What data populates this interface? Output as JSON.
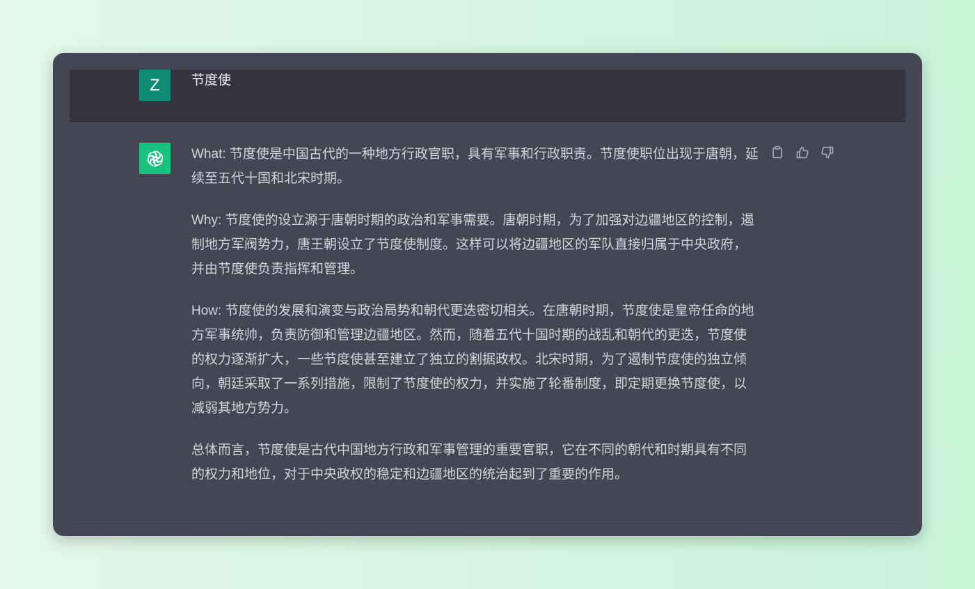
{
  "user_message": {
    "avatar_letter": "Z",
    "avatar_color": "#0f8a74",
    "text": "节度使"
  },
  "assistant_message": {
    "avatar_icon": "openai-logo-icon",
    "avatar_color": "#19c37d",
    "paragraphs": [
      "What: 节度使是中国古代的一种地方行政官职，具有军事和行政职责。节度使职位出现于唐朝，延续至五代十国和北宋时期。",
      "Why: 节度使的设立源于唐朝时期的政治和军事需要。唐朝时期，为了加强对边疆地区的控制，遏制地方军阀势力，唐王朝设立了节度使制度。这样可以将边疆地区的军队直接归属于中央政府，并由节度使负责指挥和管理。",
      "How: 节度使的发展和演变与政治局势和朝代更迭密切相关。在唐朝时期，节度使是皇帝任命的地方军事统帅，负责防御和管理边疆地区。然而，随着五代十国时期的战乱和朝代的更迭，节度使的权力逐渐扩大，一些节度使甚至建立了独立的割据政权。北宋时期，为了遏制节度使的独立倾向，朝廷采取了一系列措施，限制了节度使的权力，并实施了轮番制度，即定期更换节度使，以减弱其地方势力。",
      "总体而言，节度使是古代中国地方行政和军事管理的重要官职，它在不同的朝代和时期具有不同的权力和地位，对于中央政权的稳定和边疆地区的统治起到了重要的作用。"
    ],
    "actions": [
      "copy-icon",
      "thumbs-up-icon",
      "thumbs-down-icon"
    ]
  },
  "colors": {
    "card_bg": "#444654",
    "user_row_bg": "#343541",
    "text": "#d1d5db",
    "icon": "#acacbe"
  }
}
